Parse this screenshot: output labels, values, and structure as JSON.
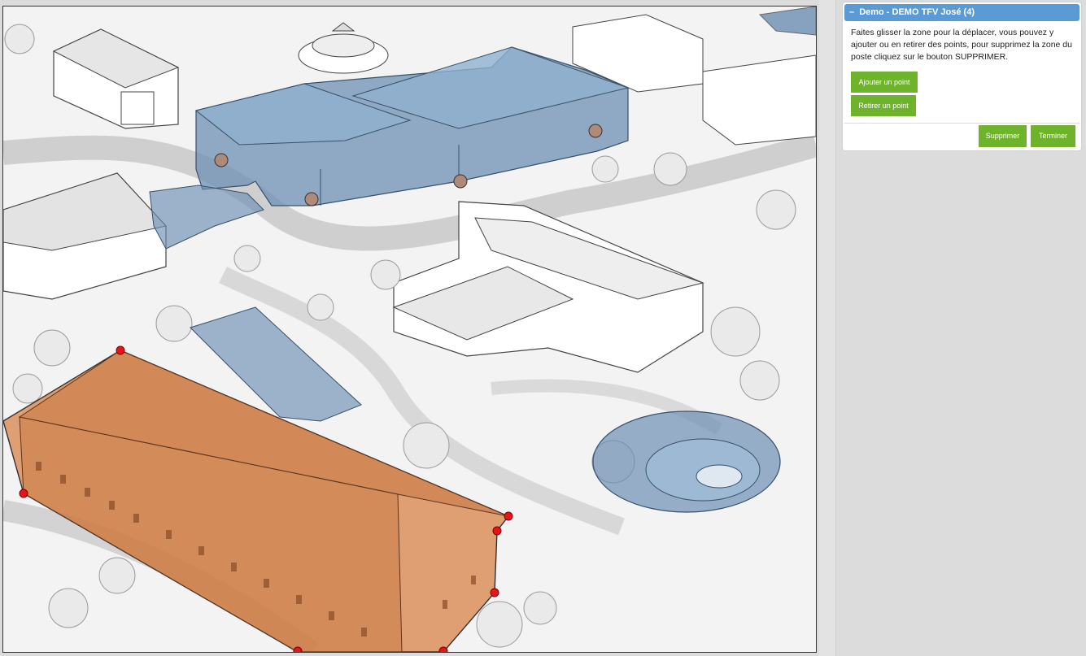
{
  "panel": {
    "collapse_glyph": "–",
    "title": "Demo - DEMO TFV José (4)",
    "help_text": "Faites glisser la zone pour la déplacer, vous pouvez y ajouter ou en retirer des points, pour supprimez la zone du poste cliquez sur le bouton SUPPRIMER.",
    "add_point_label": "Ajouter un point",
    "remove_point_label": "Retirer un point",
    "delete_label": "Supprimer",
    "finish_label": "Terminer"
  },
  "colors": {
    "selected_zone": "#d9864e",
    "zone_vertex": "#e8141b",
    "other_zones": "#6d8fb3",
    "button_green": "#6fb22c",
    "panel_header": "#5b9bd5"
  }
}
